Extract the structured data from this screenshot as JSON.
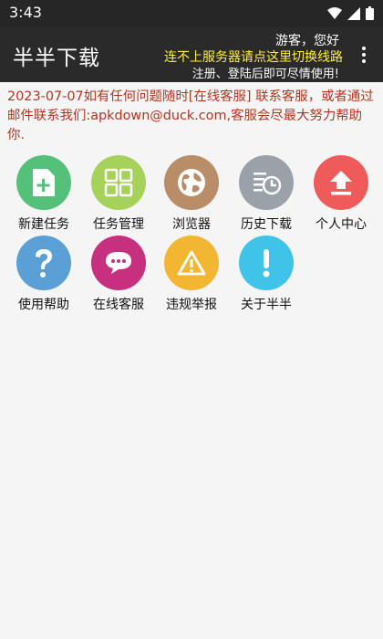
{
  "status_bar": {
    "time": "3:43"
  },
  "header": {
    "title": "半半下载",
    "greeting": "游客，您好",
    "switch_link": "连不上服务器请点这里切换线路",
    "login_tip": "注册、登陆后即可尽情使用!"
  },
  "notice": "2023-07-07如有任何问题随时[在线客服] 联系客服，或者通过邮件联系我们:apkdown@duck.com,客服会尽最大努力帮助你.",
  "tiles": [
    {
      "label": "新建任务",
      "icon": "new-task-icon",
      "color": "#55c07a"
    },
    {
      "label": "任务管理",
      "icon": "task-manage-icon",
      "color": "#a6d15b"
    },
    {
      "label": "浏览器",
      "icon": "browser-globe-icon",
      "color": "#b88d67"
    },
    {
      "label": "历史下载",
      "icon": "history-icon",
      "color": "#9aa1a8"
    },
    {
      "label": "个人中心",
      "icon": "upload-arrow-icon",
      "color": "#ef5a5a"
    },
    {
      "label": "使用帮助",
      "icon": "help-question-icon",
      "color": "#5a9fd6"
    },
    {
      "label": "在线客服",
      "icon": "chat-bubble-icon",
      "color": "#c6307f"
    },
    {
      "label": "违规举报",
      "icon": "warning-icon",
      "color": "#f2b632"
    },
    {
      "label": "关于半半",
      "icon": "info-exclamation-icon",
      "color": "#3fc3e8"
    }
  ]
}
